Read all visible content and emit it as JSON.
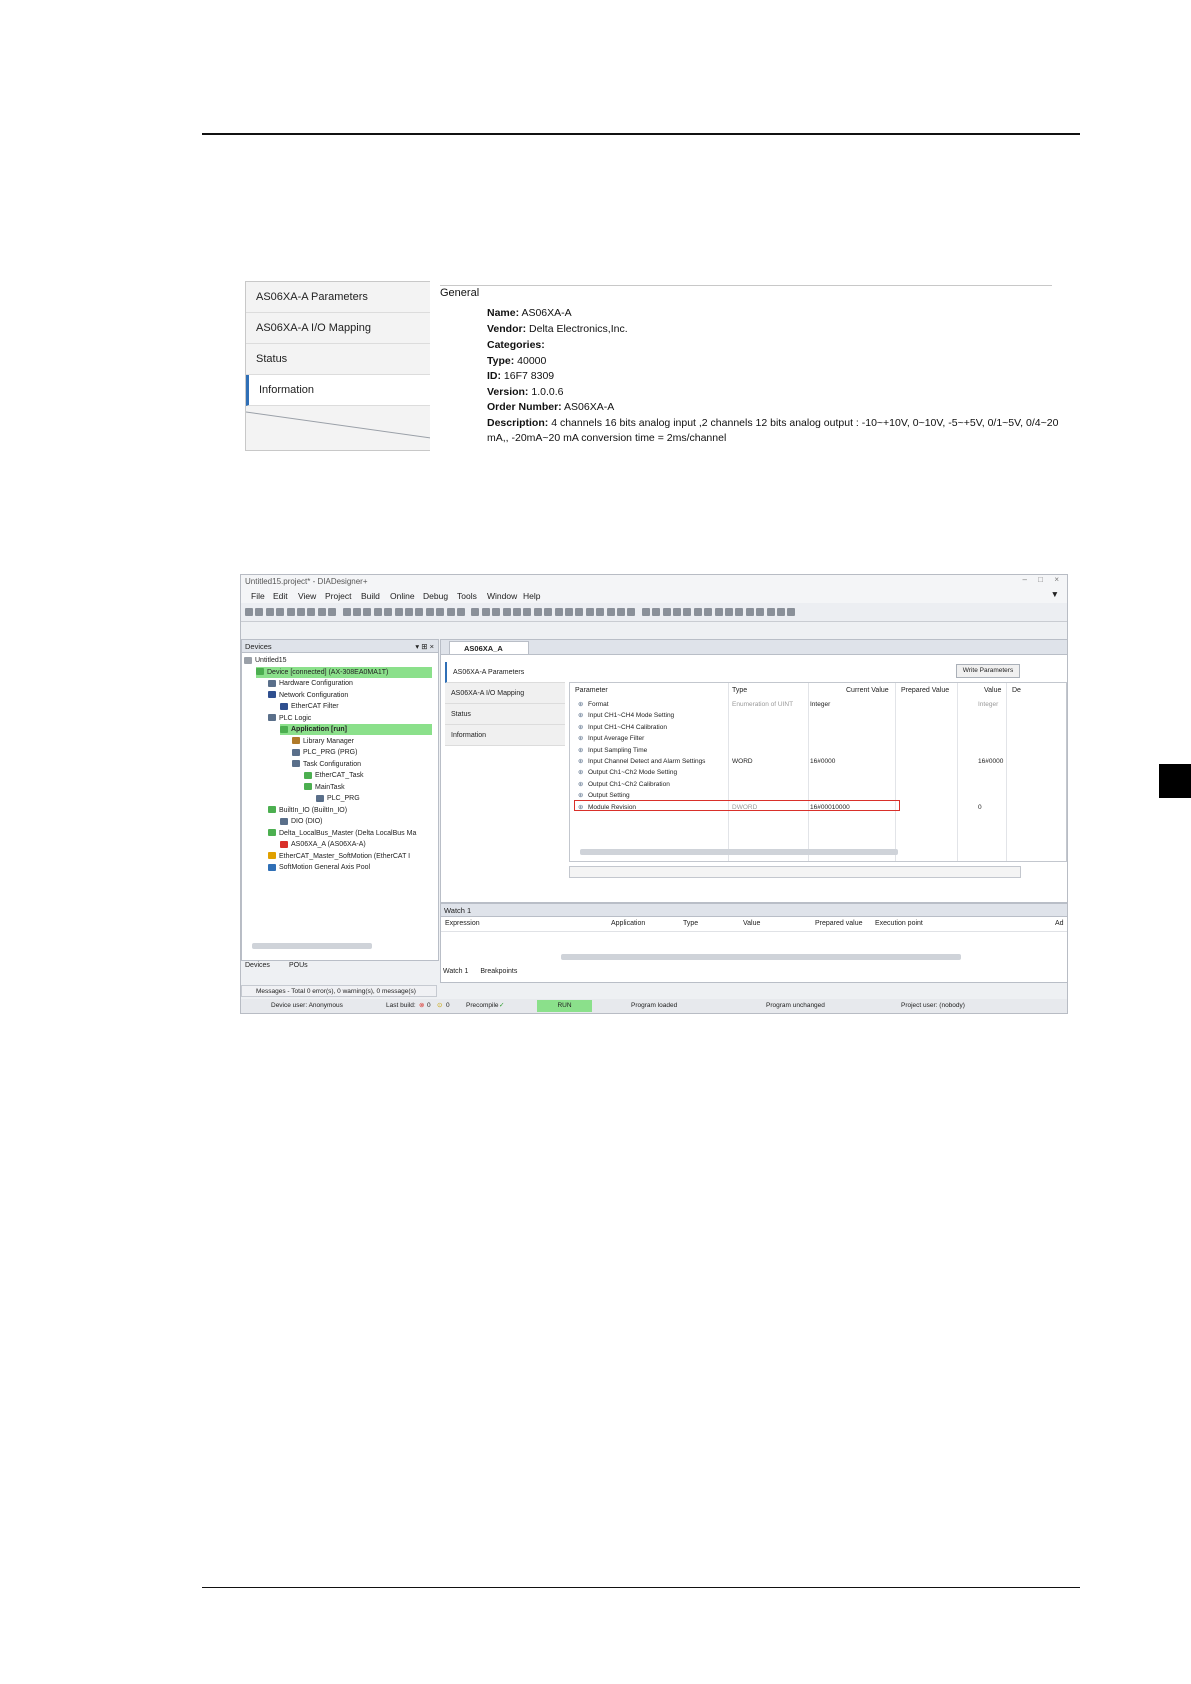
{
  "info_panel": {
    "tabs": [
      "AS06XA-A Parameters",
      "AS06XA-A I/O Mapping",
      "Status",
      "Information"
    ],
    "section_title": "General",
    "rows": [
      {
        "label": "Name:",
        "value": "AS06XA-A"
      },
      {
        "label": "Vendor:",
        "value": "Delta Electronics,Inc."
      },
      {
        "label": "Categories:",
        "value": ""
      },
      {
        "label": "Type:",
        "value": "40000"
      },
      {
        "label": "ID:",
        "value": "16F7 8309"
      },
      {
        "label": "Version:",
        "value": "1.0.0.6"
      },
      {
        "label": "Order Number:",
        "value": "AS06XA-A"
      },
      {
        "label": "Description:",
        "value": "4 channels 16 bits analog input ,2 channels 12 bits analog output : -10~+10V, 0~10V, -5~+5V, 0/1~5V, 0/4~20"
      },
      {
        "label": "",
        "value": "mA,, -20mA~20 mA conversion time = 2ms/channel"
      }
    ]
  },
  "ide": {
    "title": "Untitled15.project* - DIADesigner+",
    "menu": [
      "File",
      "Edit",
      "View",
      "Project",
      "Build",
      "Online",
      "Debug",
      "Tools",
      "Window",
      "Help"
    ],
    "devices_panel_title": "Devices",
    "tree": [
      {
        "label": "Untitled15",
        "hl": false
      },
      {
        "label": "Device [connected] (AX-308EA0MA1T)",
        "hl": true
      },
      {
        "label": "Hardware Configuration",
        "hl": false
      },
      {
        "label": "Network Configuration",
        "hl": false
      },
      {
        "label": "EtherCAT Filter",
        "hl": false
      },
      {
        "label": "PLC Logic",
        "hl": false
      },
      {
        "label": "Application [run]",
        "hl": true
      },
      {
        "label": "Library Manager",
        "hl": false
      },
      {
        "label": "PLC_PRG (PRG)",
        "hl": false
      },
      {
        "label": "Task Configuration",
        "hl": false
      },
      {
        "label": "EtherCAT_Task",
        "hl": false
      },
      {
        "label": "MainTask",
        "hl": false
      },
      {
        "label": "PLC_PRG",
        "hl": false
      },
      {
        "label": "BuiltIn_IO (BuiltIn_IO)",
        "hl": false
      },
      {
        "label": "DIO (DIO)",
        "hl": false
      },
      {
        "label": "Delta_LocalBus_Master (Delta LocalBus Ma",
        "hl": false
      },
      {
        "label": "AS06XA_A (AS06XA-A)",
        "hl": false
      },
      {
        "label": "EtherCAT_Master_SoftMotion (EtherCAT I",
        "hl": false
      },
      {
        "label": "SoftMotion General Axis Pool",
        "hl": false
      }
    ],
    "bottom_tabs": [
      "Devices",
      "POUs"
    ],
    "editor_tab": "AS06XA_A",
    "sub_tabs": [
      "AS06XA-A Parameters",
      "AS06XA-A I/O Mapping",
      "Status",
      "Information"
    ],
    "write_button": "Write Parameters",
    "grid_headers": [
      "Parameter",
      "Type",
      "Current Value",
      "Prepared Value",
      "Value",
      "De"
    ],
    "grid_rows": [
      {
        "param": "Format",
        "type": "Enumeration of UINT",
        "current": "Integer",
        "value": "Integer"
      },
      {
        "param": "Input CH1~CH4 Mode Setting",
        "type": "",
        "current": "",
        "value": ""
      },
      {
        "param": "Input CH1~CH4 Calibration",
        "type": "",
        "current": "",
        "value": ""
      },
      {
        "param": "Input Average Filter",
        "type": "",
        "current": "",
        "value": ""
      },
      {
        "param": "Input Sampling Time",
        "type": "",
        "current": "",
        "value": ""
      },
      {
        "param": "Input Channel Detect and Alarm Settings",
        "type": "WORD",
        "current": "16#0000",
        "value": "16#0000"
      },
      {
        "param": "Output Ch1~Ch2 Mode Setting",
        "type": "",
        "current": "",
        "value": ""
      },
      {
        "param": "Output Ch1~Ch2 Calibration",
        "type": "",
        "current": "",
        "value": ""
      },
      {
        "param": "Output Setting",
        "type": "",
        "current": "",
        "value": ""
      },
      {
        "param": "Module Revision",
        "type": "DWORD",
        "current": "16#00010000",
        "value": "0"
      }
    ],
    "watch_title": "Watch 1",
    "watch_headers": [
      "Expression",
      "Application",
      "Type",
      "Value",
      "Prepared value",
      "Execution point",
      "Ad"
    ],
    "watch_tabs": [
      "Watch 1",
      "Breakpoints"
    ],
    "messages": "Messages - Total 0 error(s), 0 warning(s), 0 message(s)",
    "status": {
      "device_user": "Device user: Anonymous",
      "last_build": "Last build:",
      "err": "0",
      "warn": "0",
      "precompile": "Precompile",
      "run": "RUN",
      "loaded": "Program loaded",
      "unchanged": "Program unchanged",
      "project_user": "Project user: (nobody)"
    },
    "colors": {
      "highlight": "#8be08b",
      "selection_box": "#d9302a",
      "accent": "#2f6fb6"
    }
  }
}
